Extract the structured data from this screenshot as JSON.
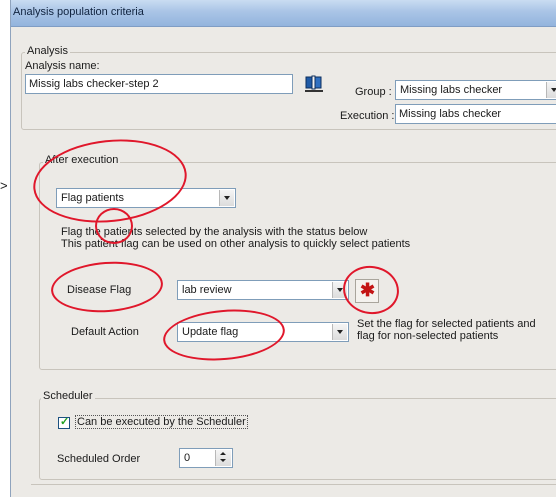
{
  "window": {
    "title": "Analysis population criteria"
  },
  "pointer_glyph": ">",
  "analysis": {
    "legend": "Analysis",
    "name_label": "Analysis name:",
    "name_value": "Missig labs  checker-step 2",
    "group_label": "Group :",
    "group_value": "Missing labs checker",
    "execution_label": "Execution :",
    "execution_value": "Missing labs  checker"
  },
  "after_execution": {
    "legend": "After execution",
    "action_value": "Flag patients",
    "description_line1": "Flag the patients selected by the analysis with the status below",
    "description_line2": "This patient flag can be used on other analysis to quickly select patients",
    "disease_flag_label": "Disease Flag",
    "disease_flag_value": "lab review",
    "default_action_label": "Default Action",
    "default_action_value": "Update flag",
    "default_action_hint_line1": "Set the flag for selected patients and",
    "default_action_hint_line2": "flag for non-selected patients"
  },
  "scheduler": {
    "legend": "Scheduler",
    "checkbox_label": "Can be executed by the Scheduler",
    "checkbox_checked": true,
    "order_label": "Scheduled Order",
    "order_value": "0"
  },
  "colors": {
    "annotation_red": "#e0172b",
    "titlebar": "#a9c4e6"
  }
}
